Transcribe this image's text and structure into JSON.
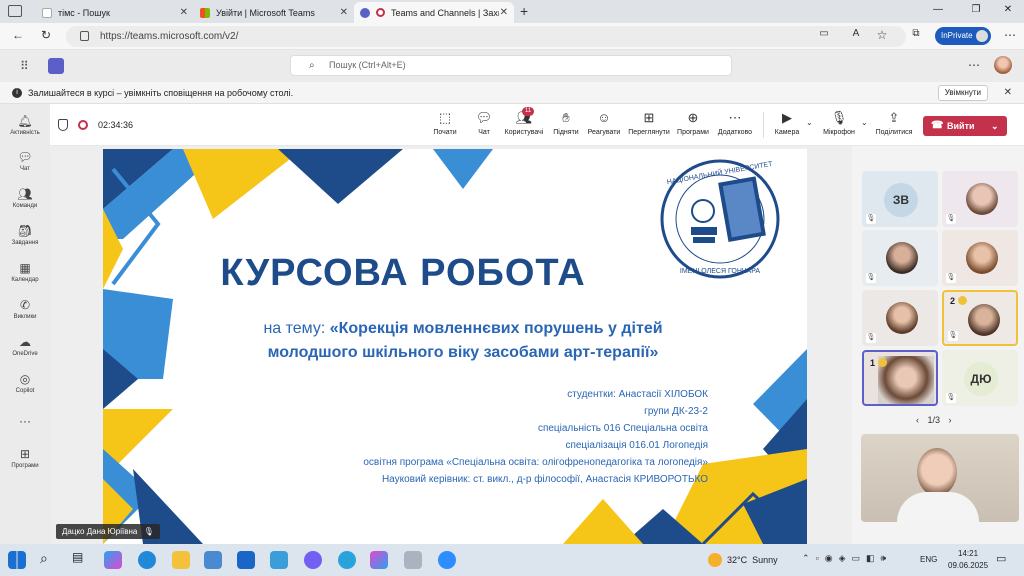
{
  "browser": {
    "tabs": [
      {
        "title": "тімс - Пошук"
      },
      {
        "title": "Увійти | Microsoft Teams"
      },
      {
        "title": "Teams and Channels | Захист"
      }
    ],
    "new_tab": "+",
    "window_controls": {
      "minimize": "—",
      "maximize": "❐",
      "close": "✕"
    },
    "url": "https://teams.microsoft.com/v2/",
    "profile_label": "InPrivate"
  },
  "teams": {
    "search_placeholder": "Пошук (Ctrl+Alt+E)",
    "notification": {
      "text": "Залишайтеся в курсі – увімкніть сповіщення на робочому столі.",
      "button": "Увімкнути"
    },
    "rail": [
      {
        "label": "Активність",
        "icon": "bell-icon"
      },
      {
        "label": "Чат",
        "icon": "chat-icon"
      },
      {
        "label": "Команди",
        "icon": "teams-icon"
      },
      {
        "label": "Завдання",
        "icon": "assignments-icon"
      },
      {
        "label": "Календар",
        "icon": "calendar-icon"
      },
      {
        "label": "Виклики",
        "icon": "phone-icon"
      },
      {
        "label": "OneDrive",
        "icon": "cloud-icon"
      },
      {
        "label": "Copilot",
        "icon": "copilot-icon"
      },
      {
        "label": "···",
        "icon": "more-icon"
      },
      {
        "label": "Програми",
        "icon": "apps-icon"
      }
    ],
    "meeting": {
      "timer": "02:34:36",
      "tools": [
        {
          "label": "Почати",
          "icon": "share-icon"
        },
        {
          "label": "Чат",
          "icon": "chat-icon"
        },
        {
          "label": "Користувачі",
          "icon": "people-icon",
          "badge": "11"
        },
        {
          "label": "Підняти",
          "icon": "hand-icon"
        },
        {
          "label": "Реагувати",
          "icon": "emoji-icon"
        },
        {
          "label": "Переглянути",
          "icon": "view-icon"
        },
        {
          "label": "Програми",
          "icon": "apps-icon"
        },
        {
          "label": "Додатково",
          "icon": "more-icon"
        },
        {
          "label": "Камера",
          "icon": "camera-icon"
        },
        {
          "label": "Мікрофон",
          "icon": "mic-icon"
        },
        {
          "label": "Поділитися",
          "icon": "share-screen-icon"
        }
      ],
      "leave_label": "Вийти",
      "presenter_name": "Дацко Дана Юріївна",
      "page_indicator": "1/3",
      "participants": [
        {
          "initials": "ЗВ"
        },
        {
          "initials": ""
        },
        {
          "initials": ""
        },
        {
          "initials": ""
        },
        {
          "initials": ""
        },
        {
          "initials": "",
          "badge": "2"
        },
        {
          "initials": "",
          "badge": "1"
        },
        {
          "initials": "ДЮ"
        }
      ]
    },
    "slide": {
      "title": "КУРСОВА РОБОТА",
      "subtitle_prefix": "на тему: ",
      "subtitle_line1": "«Корекція мовленнєвих порушень у дітей",
      "subtitle_line2": "молодшого шкільного віку засобами арт-терапії»",
      "info": [
        "студентки: Анастасії ХІЛОБОК",
        "групи ДК-23-2",
        "спеціальність 016 Спеціальна освіта",
        "спеціалізація 016.01 Логопедія",
        "освітня програма «Спеціальна освіта: олігофренопедагогіка та логопедія»",
        "Науковий керівник: ст. викл., д-р філософії, Анастасія КРИВОРОТЬКО"
      ]
    }
  },
  "taskbar": {
    "weather": "32°C  Sunny",
    "language": "ENG",
    "time": "14:21",
    "date": "09.06.2025"
  },
  "colors": {
    "slide_blue": "#1e4b8a",
    "slide_light_blue": "#3a8ed6",
    "slide_yellow": "#f5c518",
    "leave_red": "#c4314b",
    "teams_purple": "#5b5fc7"
  }
}
